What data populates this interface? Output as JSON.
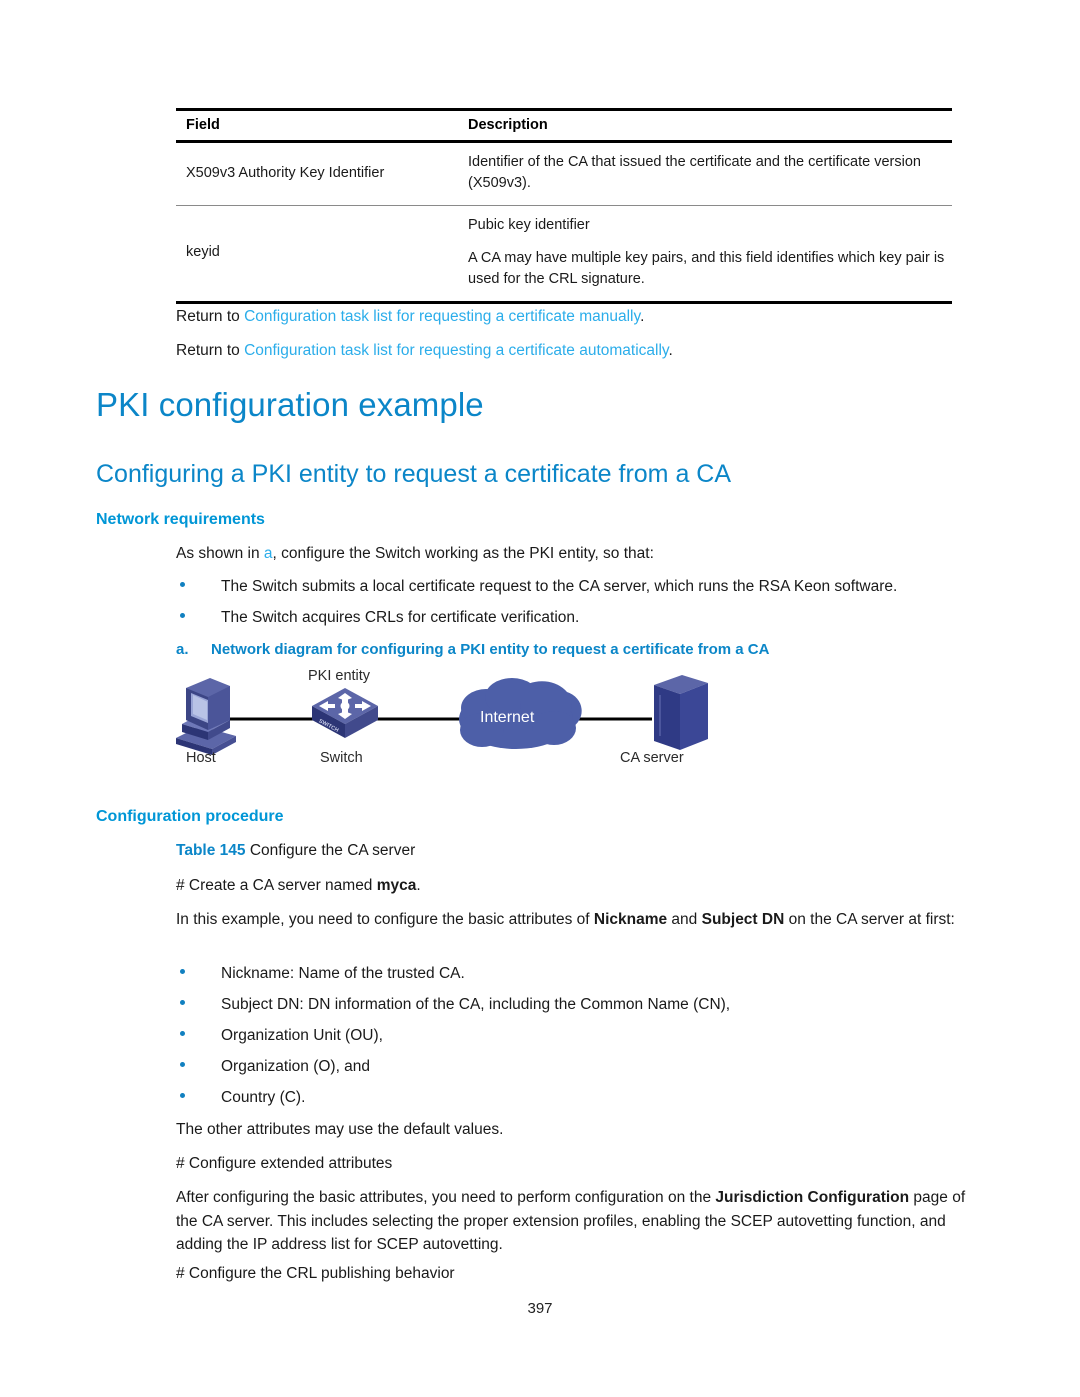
{
  "table": {
    "headers": [
      "Field",
      "Description"
    ],
    "rows": [
      {
        "field": "X509v3 Authority Key Identifier",
        "description": [
          "Identifier of the CA that issued the certificate and the certificate version (X509v3)."
        ]
      },
      {
        "field": "keyid",
        "description": [
          "Pubic key identifier",
          "A CA may have multiple key pairs, and this field identifies which key pair is used for the CRL signature."
        ]
      }
    ]
  },
  "return_links": {
    "prefix": "Return to ",
    "suffix": ".",
    "manual": "Configuration task list for requesting a certificate manually",
    "automatic": "Configuration task list for requesting a certificate automatically"
  },
  "headings": {
    "h1": "PKI configuration example",
    "h2": "Configuring a PKI entity to request a certificate from a CA",
    "network_requirements": "Network requirements",
    "configuration_procedure": "Configuration procedure"
  },
  "network_requirements": {
    "intro_before": "As shown in ",
    "intro_link": "a",
    "intro_after": ", configure the Switch working as the PKI entity, so that:",
    "bullets": [
      "The Switch submits a local certificate request to the CA server, which runs the RSA Keon software.",
      "The Switch acquires CRLs for certificate verification."
    ],
    "figure_marker": "a.",
    "figure_caption": "Network diagram for configuring a PKI entity to request a certificate from a CA"
  },
  "diagram": {
    "labels": {
      "host": "Host",
      "switch": "Switch",
      "switch_top": "PKI entity",
      "switch_face": "SWITCH",
      "cloud": "Internet",
      "ca_server": "CA server"
    },
    "colors": {
      "cloud": "#4d5fa8",
      "device_light": "#8b93c9",
      "device_mid": "#5c66a8",
      "device_dark": "#2c3575",
      "link": "#000000"
    }
  },
  "configuration_procedure": {
    "table_caption_num": "Table 145",
    "table_caption_text": " Configure the CA server",
    "create_line_before": "# Create a CA server named ",
    "create_line_bold": "myca",
    "create_line_after": ".",
    "basic_attrs_p1": "In this example, you need to configure the basic attributes of ",
    "basic_attrs_b1": "Nickname",
    "basic_attrs_p2": " and ",
    "basic_attrs_b2": "Subject DN",
    "basic_attrs_p3": " on the CA server at first:",
    "attr_bullets": [
      "Nickname: Name of the trusted CA.",
      "Subject DN: DN information of the CA, including the Common Name (CN),",
      "Organization Unit (OU),",
      "Organization (O), and",
      "Country (C)."
    ],
    "defaults_line": "The other attributes may use the default values.",
    "extended_attrs_heading": "# Configure extended attributes",
    "extended_p1": "After configuring the basic attributes, you need to perform configuration on the ",
    "extended_b1": "Jurisdiction Configuration",
    "extended_p2": " page of the CA server. This includes selecting the proper extension profiles, enabling the SCEP autovetting function, and adding the IP address list for SCEP autovetting.",
    "crl_line": "# Configure the CRL publishing behavior"
  },
  "page_number": "397"
}
